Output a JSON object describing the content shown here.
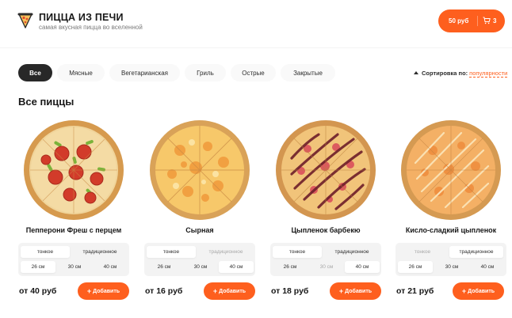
{
  "header": {
    "title": "ПИЦЦА ИЗ ПЕЧИ",
    "subtitle": "самая вкусная пицца во вселенной",
    "logo_icon": "pizza-slice-icon",
    "cart": {
      "price": "50 руб",
      "count": "3",
      "icon": "shopping-cart-icon"
    }
  },
  "categories": [
    "Все",
    "Мясные",
    "Вегетарианская",
    "Гриль",
    "Острые",
    "Закрытые"
  ],
  "active_category": "Все",
  "sort": {
    "label": "Сортировка по:",
    "value": "популярности"
  },
  "section_title": "Все пиццы",
  "colors": {
    "accent": "#fe5f1e",
    "dark": "#282828",
    "option_bg": "#f3f3f3"
  },
  "pizzas": [
    {
      "name": "Пепперони Фреш с перцем",
      "types": [
        "тонкое",
        "традиционное"
      ],
      "selected_type": "тонкое",
      "disabled_types": [],
      "sizes": [
        "26 см",
        "30 см",
        "40 см"
      ],
      "selected_size": "26 см",
      "disabled_sizes": [],
      "price": "от 40 руб",
      "add_label": "Добавить"
    },
    {
      "name": "Сырная",
      "types": [
        "тонкое",
        "традиционное"
      ],
      "selected_type": "тонкое",
      "disabled_types": [
        "традиционное"
      ],
      "sizes": [
        "26 см",
        "30 см",
        "40 см"
      ],
      "selected_size": "40 см",
      "disabled_sizes": [],
      "price": "от 16 руб",
      "add_label": "Добавить"
    },
    {
      "name": "Цыпленок барбекю",
      "types": [
        "тонкое",
        "традиционное"
      ],
      "selected_type": "тонкое",
      "disabled_types": [],
      "sizes": [
        "26 см",
        "30 см",
        "40 см"
      ],
      "selected_size": "40 см",
      "disabled_sizes": [
        "30 см"
      ],
      "price": "от 18 руб",
      "add_label": "Добавить"
    },
    {
      "name": "Кисло-сладкий цыпленок",
      "types": [
        "тонкое",
        "традиционное"
      ],
      "selected_type": "традиционное",
      "disabled_types": [
        "тонкое"
      ],
      "sizes": [
        "26 см",
        "30 см",
        "40 см"
      ],
      "selected_size": "26 см",
      "disabled_sizes": [],
      "price": "от 21 руб",
      "add_label": "Добавить"
    }
  ]
}
